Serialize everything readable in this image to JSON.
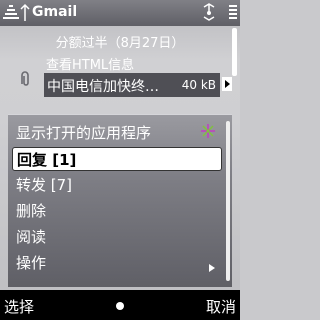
{
  "app": {
    "title": "Gmail",
    "date_header": "分额过半（8月27日）",
    "items": [
      {
        "label": "查看HTML信息"
      },
      {
        "subject": "中国电信加快终…",
        "size": "40 kB"
      }
    ]
  },
  "menu": {
    "items": [
      {
        "label": "显示打开的应用程序"
      },
      {
        "label": "回复 [1]"
      },
      {
        "label": "转发 [7]"
      },
      {
        "label": "删除"
      },
      {
        "label": "阅读"
      },
      {
        "label": "操作"
      }
    ],
    "selected_index": 1
  },
  "softkeys": {
    "left": "选择",
    "right": "取消"
  }
}
